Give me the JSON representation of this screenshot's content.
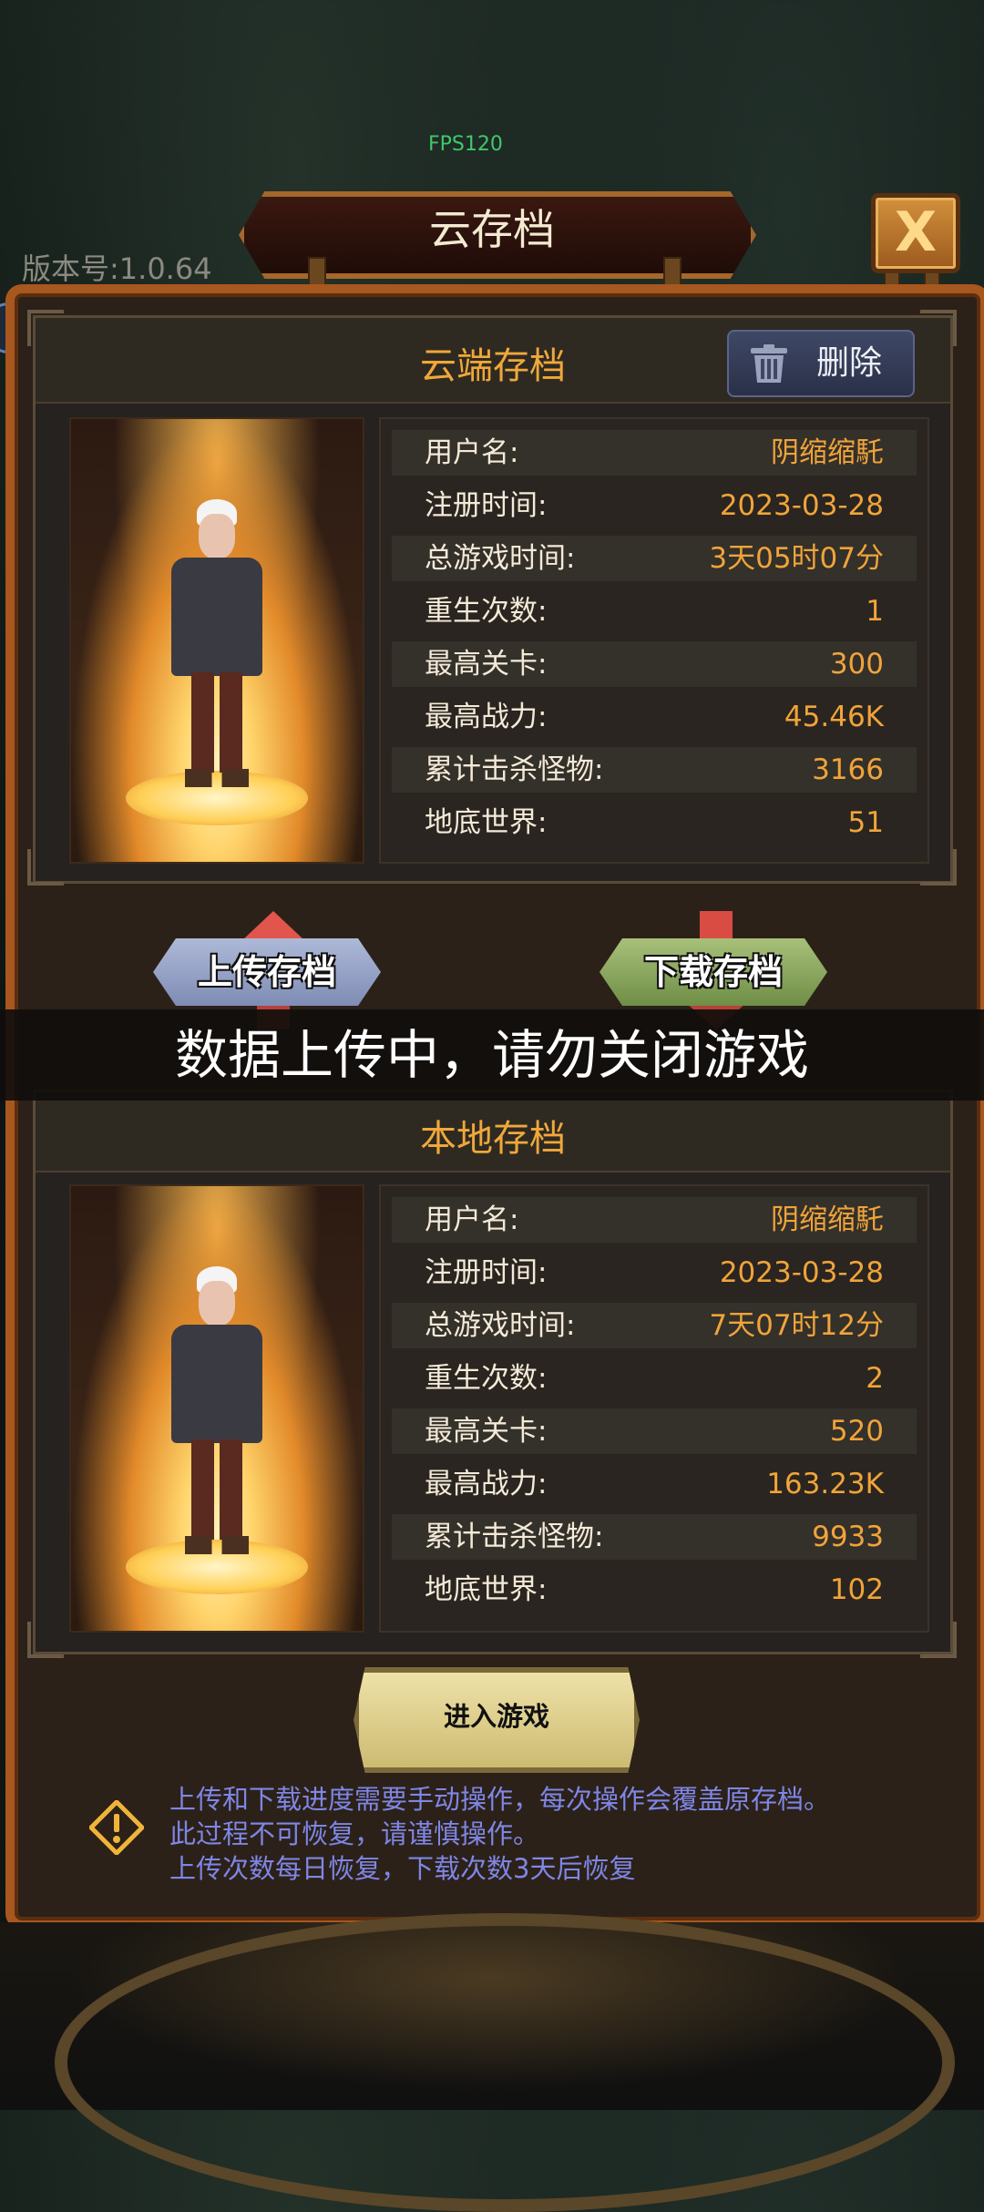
{
  "hud": {
    "fps": "FPS120",
    "version": "版本号:1.0.64"
  },
  "dialog": {
    "title": "云存档",
    "close_label": "X"
  },
  "cloud": {
    "title": "云端存档",
    "delete_label": "删除",
    "rows": [
      {
        "label": "用户名:",
        "value": "阴缩缩馲"
      },
      {
        "label": "注册时间:",
        "value": "2023-03-28"
      },
      {
        "label": "总游戏时间:",
        "value": "3天05时07分"
      },
      {
        "label": "重生次数:",
        "value": "1"
      },
      {
        "label": "最高关卡:",
        "value": "300"
      },
      {
        "label": "最高战力:",
        "value": "45.46K"
      },
      {
        "label": "累计击杀怪物:",
        "value": "3166"
      },
      {
        "label": "地底世界:",
        "value": "51"
      }
    ]
  },
  "actions": {
    "upload_label": "上传存档",
    "download_label": "下载存档"
  },
  "toast": "数据上传中，请勿关闭游戏",
  "local": {
    "title": "本地存档",
    "rows": [
      {
        "label": "用户名:",
        "value": "阴缩缩馲"
      },
      {
        "label": "注册时间:",
        "value": "2023-03-28"
      },
      {
        "label": "总游戏时间:",
        "value": "7天07时12分"
      },
      {
        "label": "重生次数:",
        "value": "2"
      },
      {
        "label": "最高关卡:",
        "value": "520"
      },
      {
        "label": "最高战力:",
        "value": "163.23K"
      },
      {
        "label": "累计击杀怪物:",
        "value": "9933"
      },
      {
        "label": "地底世界:",
        "value": "102"
      }
    ]
  },
  "enter_label": "进入游戏",
  "notice": [
    "上传和下载进度需要手动操作，每次操作会覆盖原存档。",
    "此过程不可恢复，请谨慎操作。",
    "上传次数每日恢复，下载次数3天后恢复"
  ],
  "colors": {
    "accent": "#f0a43a",
    "frame": "#a8571e",
    "notice": "#7f86e6"
  },
  "icons": {
    "close": "close-icon",
    "delete": "trash-icon",
    "warning": "warning-icon"
  }
}
